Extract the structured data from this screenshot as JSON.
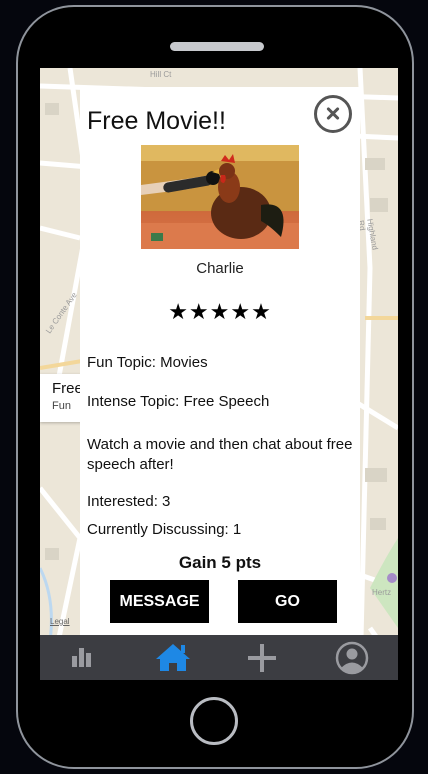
{
  "map": {
    "streets": [
      "Hill Ct",
      "Highland Rd",
      "Le Conte Ave",
      "Hertz"
    ],
    "legal": "Legal"
  },
  "peek": {
    "title": "Free",
    "subtitle": "Fun"
  },
  "modal": {
    "title": "Free Movie!!",
    "host_name": "Charlie",
    "rating": {
      "stars_text": "★★★★★",
      "value": 5,
      "max": 5
    },
    "fun_topic": "Fun Topic: Movies",
    "intense_topic": "Intense Topic: Free Speech",
    "description": "Watch a movie and then chat about free speech after!",
    "interested": "Interested: 3",
    "discussing": "Currently Discussing: 1",
    "gain": "Gain 5 pts",
    "buttons": {
      "message": "MESSAGE",
      "go": "GO"
    }
  },
  "tabbar": {
    "items": [
      {
        "icon": "bar-chart-icon",
        "active": false
      },
      {
        "icon": "home-icon",
        "active": true
      },
      {
        "icon": "plus-icon",
        "active": false
      },
      {
        "icon": "profile-icon",
        "active": false
      }
    ],
    "active_color": "#1e88e5",
    "inactive_color": "#9a9ba0"
  },
  "colors": {
    "phone_bezel": "#000000",
    "phone_frame": "#8f949c",
    "tabbar_bg": "#3c3d42"
  }
}
